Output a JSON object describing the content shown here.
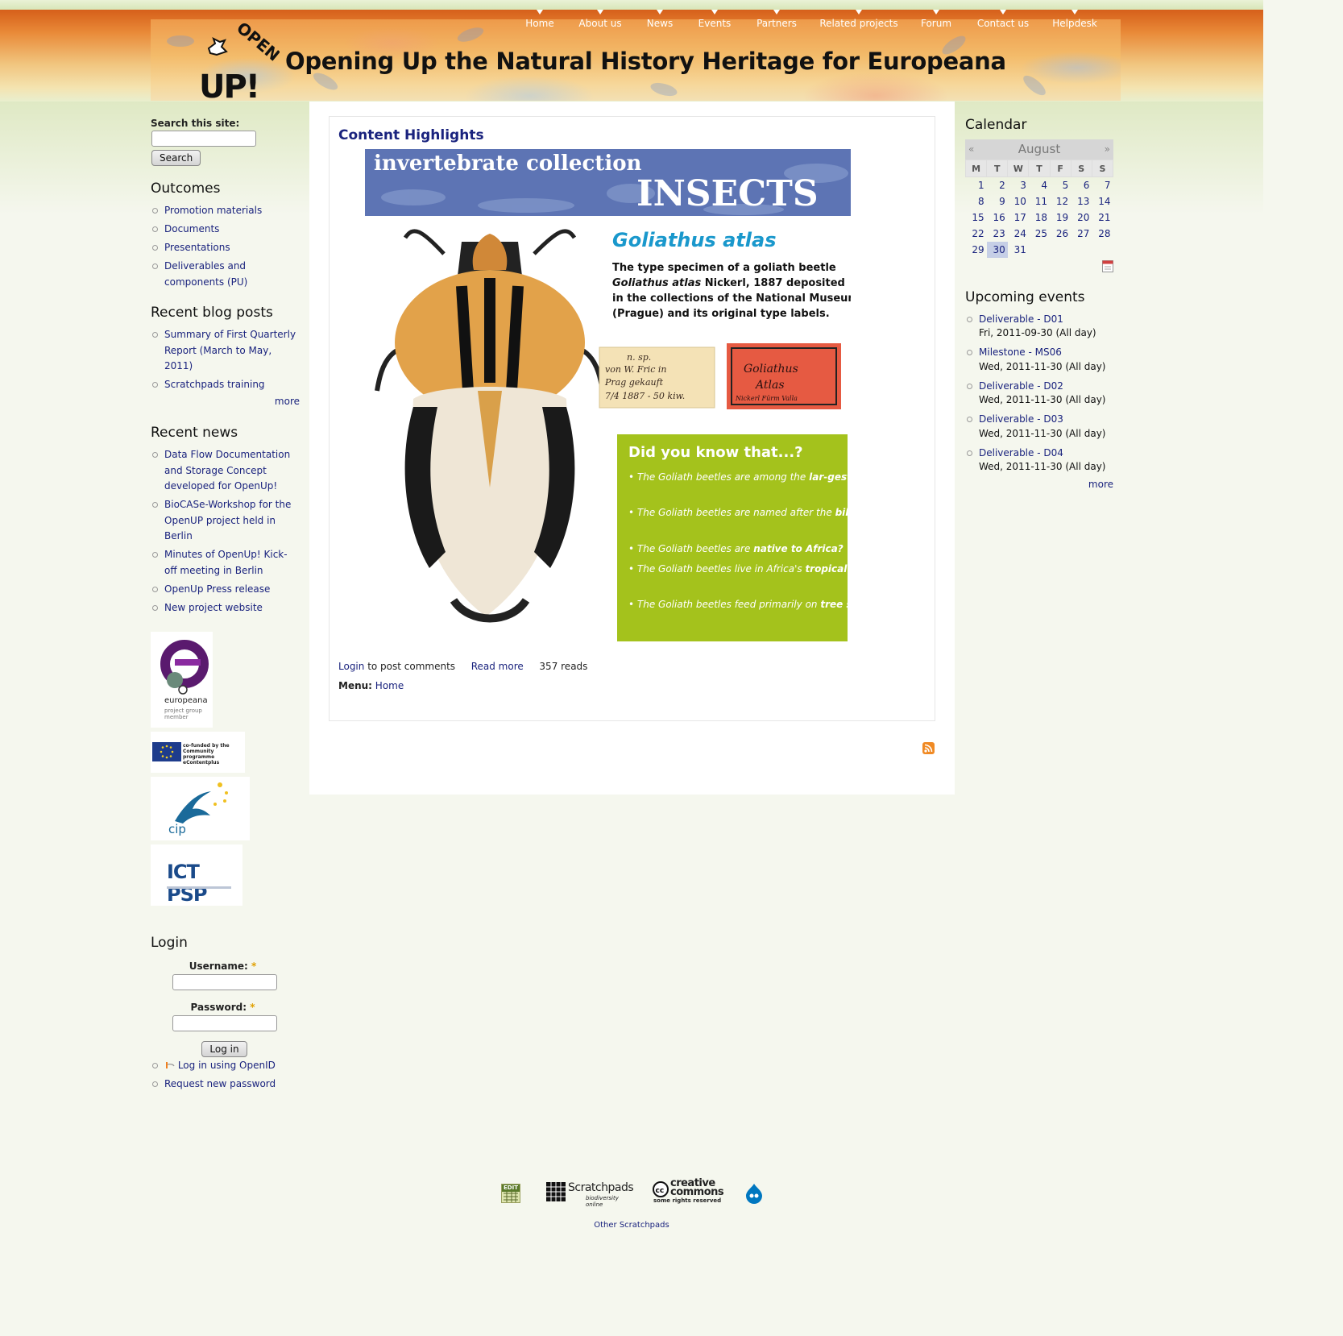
{
  "site": {
    "title": "Opening Up the Natural History Heritage for Europeana",
    "logo_text_top": "OPEN",
    "logo_text_bottom": "UP!"
  },
  "nav": [
    {
      "label": "Home",
      "name": "nav-home"
    },
    {
      "label": "About us",
      "name": "nav-about-us"
    },
    {
      "label": "News",
      "name": "nav-news"
    },
    {
      "label": "Events",
      "name": "nav-events"
    },
    {
      "label": "Partners",
      "name": "nav-partners"
    },
    {
      "label": "Related projects",
      "name": "nav-related-projects"
    },
    {
      "label": "Forum",
      "name": "nav-forum"
    },
    {
      "label": "Contact us",
      "name": "nav-contact-us"
    },
    {
      "label": "Helpdesk",
      "name": "nav-helpdesk"
    }
  ],
  "search": {
    "label": "Search this site:",
    "button": "Search",
    "value": ""
  },
  "outcomes": {
    "title": "Outcomes",
    "items": [
      "Promotion materials",
      "Documents",
      "Presentations",
      "Deliverables and components (PU)"
    ]
  },
  "blog": {
    "title": "Recent blog posts",
    "items": [
      "Summary of First Quarterly Report (March to May, 2011)",
      "Scratchpads training"
    ],
    "more": "more"
  },
  "news": {
    "title": "Recent news",
    "items": [
      "Data Flow Documentation and Storage Concept developed for OpenUp!",
      "BioCASe-Workshop for the OpenUP project held in Berlin",
      "Minutes of OpenUp! Kick-off meeting in Berlin",
      "OpenUp Press release",
      "New project website"
    ]
  },
  "sponsors": {
    "europeana": "europeana",
    "europeana_sub": "project group member",
    "eu": "co-funded by the Community programme eContentplus",
    "cip": "cip",
    "ictpsp": "ICT PSP"
  },
  "login": {
    "title": "Login",
    "username_label": "Username:",
    "password_label": "Password:",
    "required": "*",
    "button": "Log in",
    "openid": "Log in using OpenID",
    "request": "Request new password"
  },
  "content": {
    "title": "Content Highlights",
    "poster": {
      "header_small": "invertebrate collection",
      "header_big": "INSECTS",
      "species": "Goliathus atlas",
      "desc_line1": "The type specimen of a goliath beetle",
      "desc_line2_italic": "Goliathus atlas",
      "desc_line2_rest": " Nickerl, 1887 deposited",
      "desc_line3": "in the collections of the National Museum",
      "desc_line4": "(Prague) and its original type labels.",
      "label1": [
        "n. sp.",
        "von W. Fric in",
        "Prag gekauft",
        "7/4 1887 - 50 kiw."
      ],
      "label2": [
        "Goliathus",
        "Atlas",
        "Nickerl  Fürm Valla"
      ],
      "dyk_title": "Did you know that...?",
      "facts": [
        [
          "The Goliath beetles are among the ",
          "lar-gest insects on Earth?"
        ],
        [
          "The Goliath beetles are named after the ",
          "biblical giant Goliath?"
        ],
        [
          "The Goliath beetles are ",
          "native to Africa?"
        ],
        [
          "The Goliath beetles live in Africa's ",
          "tropical forests?"
        ],
        [
          "The Goliath beetles feed primarily on ",
          "tree sap and fruit?"
        ]
      ]
    },
    "login_link": "Login",
    "post_comments": " to post comments",
    "read_more": "Read more",
    "reads": "357 reads",
    "menu_label": "Menu:",
    "menu_link": "Home"
  },
  "calendar": {
    "title": "Calendar",
    "month": "August",
    "prev": "«",
    "next": "»",
    "days": [
      "M",
      "T",
      "W",
      "T",
      "F",
      "S",
      "S"
    ],
    "weeks": [
      [
        "1",
        "2",
        "3",
        "4",
        "5",
        "6",
        "7"
      ],
      [
        "8",
        "9",
        "10",
        "11",
        "12",
        "13",
        "14"
      ],
      [
        "15",
        "16",
        "17",
        "18",
        "19",
        "20",
        "21"
      ],
      [
        "22",
        "23",
        "24",
        "25",
        "26",
        "27",
        "28"
      ],
      [
        "29",
        "30",
        "31",
        "",
        "",
        "",
        ""
      ]
    ],
    "today": "30"
  },
  "events": {
    "title": "Upcoming events",
    "items": [
      {
        "name": "Deliverable - D01",
        "date": "Fri, 2011-09-30 (All day)"
      },
      {
        "name": "Milestone - MS06",
        "date": "Wed, 2011-11-30 (All day)"
      },
      {
        "name": "Deliverable - D02",
        "date": "Wed, 2011-11-30 (All day)"
      },
      {
        "name": "Deliverable - D03",
        "date": "Wed, 2011-11-30 (All day)"
      },
      {
        "name": "Deliverable - D04",
        "date": "Wed, 2011-11-30 (All day)"
      }
    ],
    "more": "more"
  },
  "footer": {
    "edit": "EDIT",
    "scratchpads": "Scratchpads",
    "scratchpads_sub": "biodiversity online",
    "cc": "creative commons",
    "cc_sub": "some rights reserved",
    "other": "Other Scratchpads"
  }
}
